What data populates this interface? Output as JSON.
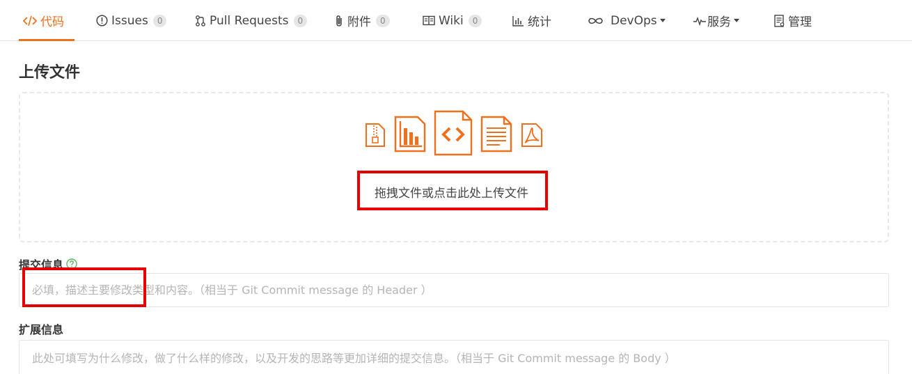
{
  "tabs": [
    {
      "label": "代码",
      "icon": "code-icon",
      "active": true
    },
    {
      "label": "Issues",
      "icon": "alert-circle-icon",
      "badge": "0"
    },
    {
      "label": "Pull Requests",
      "icon": "pull-request-icon",
      "badge": "0"
    },
    {
      "label": "附件",
      "icon": "paperclip-icon",
      "badge": "0"
    },
    {
      "label": "Wiki",
      "icon": "book-icon",
      "badge": "0"
    },
    {
      "label": "统计",
      "icon": "bar-chart-icon"
    },
    {
      "label": "DevOps",
      "icon": "infinity-icon",
      "dropdown": true
    },
    {
      "label": "服务",
      "icon": "pulse-icon",
      "dropdown": true
    },
    {
      "label": "管理",
      "icon": "clipboard-icon"
    }
  ],
  "page": {
    "title": "上传文件"
  },
  "dropzone": {
    "text": "拖拽文件或点击此处上传文件",
    "file_icons": [
      "zip-file-icon",
      "chart-file-icon",
      "code-file-icon",
      "text-file-icon",
      "pdf-file-icon"
    ]
  },
  "commit": {
    "label": "提交信息",
    "placeholder": "必填，描述主要修改类型和内容。（相当于 Git Commit message 的 Header ）"
  },
  "extended": {
    "label": "扩展信息",
    "placeholder": "此处可填写为什么修改，做了什么样的修改，以及开发的思路等更加详细的提交信息。（相当于 Git Commit message 的 Body ）"
  },
  "colors": {
    "accent": "#f06f1d",
    "highlight": "#e60000",
    "help_green": "#5cb85c"
  }
}
